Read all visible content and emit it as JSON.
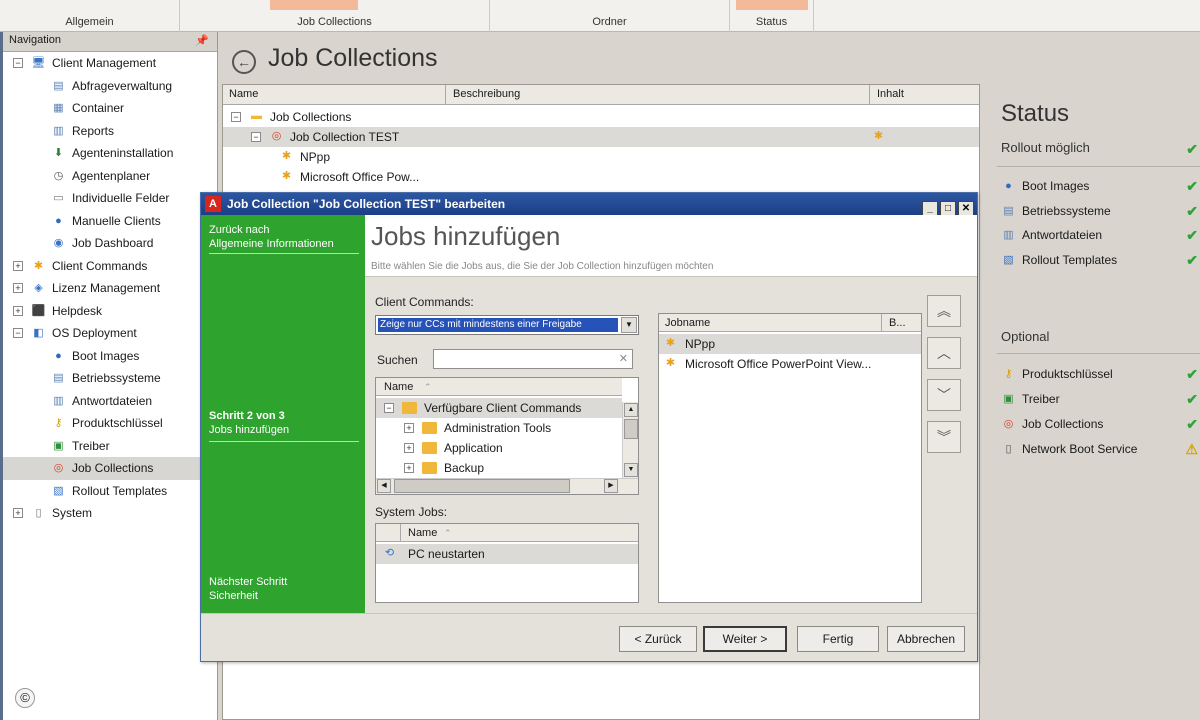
{
  "ribbon": {
    "groups": [
      "Allgemein",
      "Job Collections",
      "Ordner",
      "Status"
    ],
    "accent": "#f2b99b"
  },
  "nav": {
    "header": "Navigation",
    "items": [
      {
        "label": "Client Management",
        "icon": "client-management-icon",
        "level": 0,
        "expander": "⊟"
      },
      {
        "label": "Abfrageverwaltung",
        "icon": "query-icon",
        "level": 1
      },
      {
        "label": "Container",
        "icon": "container-icon",
        "level": 1
      },
      {
        "label": "Reports",
        "icon": "reports-icon",
        "level": 1
      },
      {
        "label": "Agenteninstallation",
        "icon": "agent-install-icon",
        "level": 1
      },
      {
        "label": "Agentenplaner",
        "icon": "clock-icon",
        "level": 1
      },
      {
        "label": "Individuelle Felder",
        "icon": "fields-icon",
        "level": 1
      },
      {
        "label": "Manuelle Clients",
        "icon": "globe-icon",
        "level": 1
      },
      {
        "label": "Job Dashboard",
        "icon": "dashboard-icon",
        "level": 1
      },
      {
        "label": "Client Commands",
        "icon": "client-commands-icon",
        "level": 0,
        "expander": "⊞"
      },
      {
        "label": "Lizenz Management",
        "icon": "license-icon",
        "level": 0,
        "expander": "⊞"
      },
      {
        "label": "Helpdesk",
        "icon": "helpdesk-icon",
        "level": 0,
        "expander": "⊞"
      },
      {
        "label": "OS Deployment",
        "icon": "os-deployment-icon",
        "level": 0,
        "expander": "⊟"
      },
      {
        "label": "Boot Images",
        "icon": "boot-images-icon",
        "level": 1
      },
      {
        "label": "Betriebssysteme",
        "icon": "os-icon",
        "level": 1
      },
      {
        "label": "Antwortdateien",
        "icon": "answer-files-icon",
        "level": 1
      },
      {
        "label": "Produktschlüssel",
        "icon": "key-icon",
        "level": 1
      },
      {
        "label": "Treiber",
        "icon": "driver-icon",
        "level": 1
      },
      {
        "label": "Job Collections",
        "icon": "job-collections-icon",
        "level": 1,
        "selected": true
      },
      {
        "label": "Rollout Templates",
        "icon": "rollout-templates-icon",
        "level": 1
      },
      {
        "label": "System",
        "icon": "system-icon",
        "level": 0,
        "expander": "⊞"
      }
    ]
  },
  "main": {
    "title": "Job Collections",
    "columns": [
      "Name",
      "Beschreibung",
      "Inhalt"
    ],
    "rows": [
      {
        "label": "Job Collections",
        "level": 0
      },
      {
        "label": "Job Collection TEST",
        "level": 1,
        "selected": true
      },
      {
        "label": "NPpp",
        "level": 2
      },
      {
        "label": "Microsoft Office Pow...",
        "level": 2
      }
    ]
  },
  "status": {
    "title": "Status",
    "subtitle": "Rollout möglich",
    "items": [
      "Boot Images",
      "Betriebssysteme",
      "Antwortdateien",
      "Rollout Templates"
    ],
    "optional_title": "Optional",
    "optional_items": [
      {
        "label": "Produktschlüssel",
        "state": "ok"
      },
      {
        "label": "Treiber",
        "state": "ok"
      },
      {
        "label": "Job Collections",
        "state": "ok"
      },
      {
        "label": "Network Boot Service",
        "state": "warn"
      }
    ],
    "ok_color": "#2ea336",
    "warn_color": "#d9a400"
  },
  "dialog": {
    "title": "Job Collection \"Job Collection TEST\" bearbeiten",
    "side": {
      "back_line1": "Zurück nach",
      "back_line2": "Allgemeine Informationen",
      "step_line1": "Schritt 2 von 3",
      "step_line2": "Jobs hinzufügen",
      "next_line1": "Nächster Schritt",
      "next_line2": "Sicherheit"
    },
    "heading": "Jobs hinzufügen",
    "subheading": "Bitte wählen Sie die Jobs aus, die Sie der Job Collection hinzufügen möchten",
    "client_commands_label": "Client Commands:",
    "filter_value": "Zeige nur CCs mit mindestens einer Freigabe",
    "search_label": "Suchen",
    "search_value": "",
    "tree_header": "Name",
    "tree_items": [
      {
        "label": "Verfügbare Client Commands",
        "level": 0,
        "expander": "⊟"
      },
      {
        "label": "Administration Tools",
        "level": 1,
        "expander": "⊞"
      },
      {
        "label": "Application",
        "level": 1,
        "expander": "⊞"
      },
      {
        "label": "Backup",
        "level": 1,
        "expander": "⊞"
      }
    ],
    "system_jobs_label": "System Jobs:",
    "system_jobs_header": "Name",
    "system_jobs": [
      "PC neustarten"
    ],
    "jobs_header": "Jobname",
    "jobs_header2": "B...",
    "jobs": [
      "NPpp",
      "Microsoft Office PowerPoint View..."
    ],
    "buttons": {
      "back": "< Zurück",
      "next": "Weiter >",
      "finish": "Fertig",
      "cancel": "Abbrechen"
    },
    "green": "#2ea32e",
    "title_blue": "#2d57a3"
  }
}
